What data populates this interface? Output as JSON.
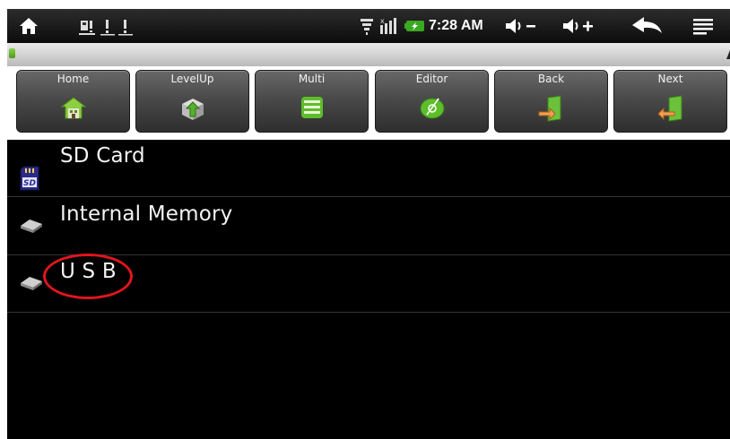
{
  "status_bar": {
    "time": "7:28 AM",
    "icons": [
      "home-icon",
      "notification-icons",
      "wifi-icon",
      "signal-icon",
      "battery-icon",
      "volume-down-icon",
      "volume-up-icon",
      "back-icon",
      "menu-icon"
    ]
  },
  "toolbar": {
    "buttons": [
      {
        "label": "Home",
        "icon": "house-icon"
      },
      {
        "label": "LevelUp",
        "icon": "levelup-box-icon"
      },
      {
        "label": "Multi",
        "icon": "multi-list-icon"
      },
      {
        "label": "Editor",
        "icon": "editor-disc-icon"
      },
      {
        "label": "Back",
        "icon": "door-back-icon"
      },
      {
        "label": "Next",
        "icon": "door-next-icon"
      }
    ]
  },
  "storage_list": [
    {
      "label": "SD Card",
      "icon": "sd-card-icon"
    },
    {
      "label": "Internal Memory",
      "icon": "drive-icon"
    },
    {
      "label": "U S B",
      "icon": "drive-icon"
    }
  ],
  "sd_icon_text": "SD",
  "colors": {
    "highlight_circle": "#e0161c",
    "accent_green": "#6cc13a",
    "background": "#000000"
  }
}
